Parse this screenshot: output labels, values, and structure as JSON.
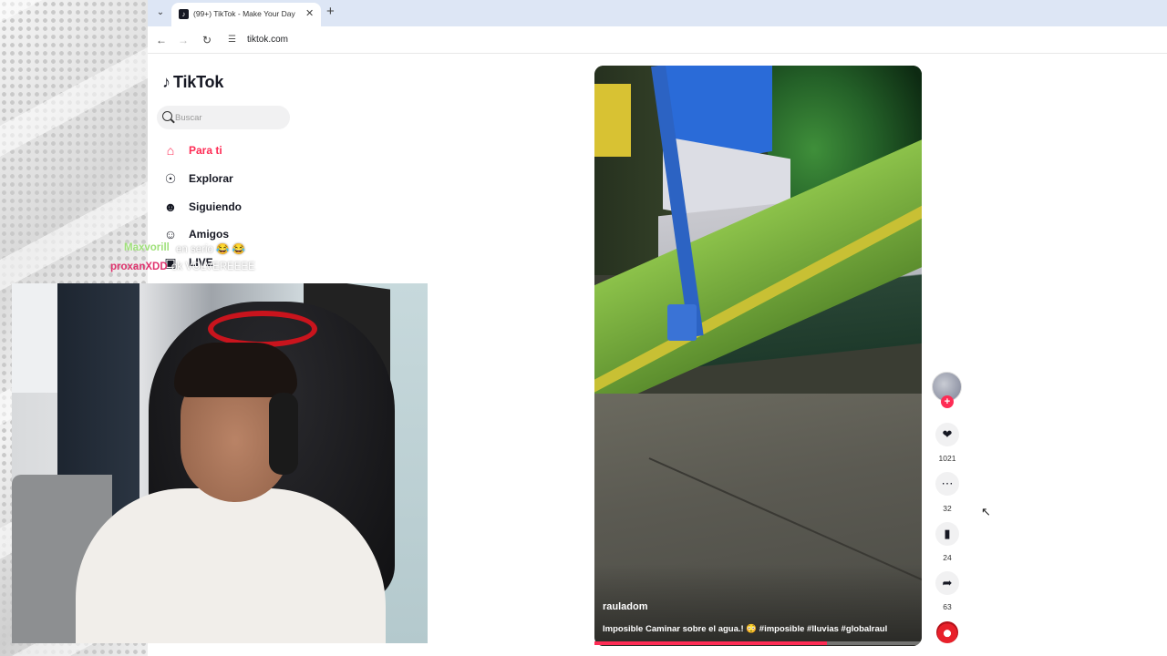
{
  "browser": {
    "tab_title": "(99+) TikTok - Make Your Day",
    "url": "tiktok.com"
  },
  "tiktok": {
    "logo_text": "TikTok",
    "search_placeholder": "Buscar",
    "nav": [
      {
        "label": "Para ti",
        "icon": "home-icon",
        "active": true
      },
      {
        "label": "Explorar",
        "icon": "compass-icon"
      },
      {
        "label": "Siguiendo",
        "icon": "following-icon"
      },
      {
        "label": "Amigos",
        "icon": "friends-icon"
      },
      {
        "label": "LIVE",
        "icon": "live-icon"
      }
    ],
    "video": {
      "author": "rauladom",
      "caption": "Imposible Caminar sobre el agua.! 😳 #imposible #lluvias #globalraul",
      "progress": 0.71
    },
    "actions": {
      "likes": "1021",
      "comments": "32",
      "saves": "24",
      "shares": "63"
    }
  },
  "chat": [
    {
      "user": "Maxvorill",
      "message": "en serio 😂 😂",
      "user_color": "#9fe07a"
    },
    {
      "user": "proxanXDD",
      "message": "ok VOLVEREEEE",
      "user_color": "#e0336e"
    }
  ],
  "colors": {
    "accent": "#fe2c55",
    "tab_strip": "#dde6f5"
  }
}
